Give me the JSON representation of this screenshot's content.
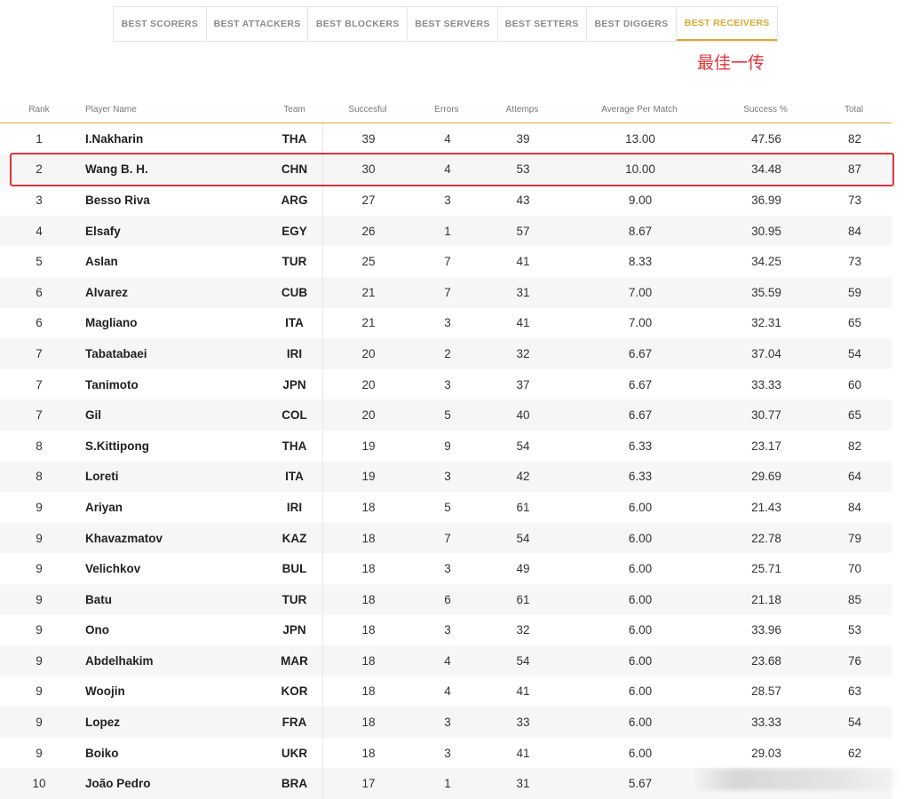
{
  "tabs": [
    {
      "label": "BEST SCORERS",
      "active": false
    },
    {
      "label": "BEST ATTACKERS",
      "active": false
    },
    {
      "label": "BEST BLOCKERS",
      "active": false
    },
    {
      "label": "BEST SERVERS",
      "active": false
    },
    {
      "label": "BEST SETTERS",
      "active": false
    },
    {
      "label": "BEST DIGGERS",
      "active": false
    },
    {
      "label": "BEST RECEIVERS",
      "active": true
    }
  ],
  "annotation": "最佳一传",
  "columns": [
    "Rank",
    "Player Name",
    "Team",
    "Succesful",
    "Errors",
    "Attemps",
    "Average Per Match",
    "Success %",
    "Total"
  ],
  "rows": [
    [
      "1",
      "I.Nakharin",
      "THA",
      "39",
      "4",
      "39",
      "13.00",
      "47.56",
      "82"
    ],
    [
      "2",
      "Wang B. H.",
      "CHN",
      "30",
      "4",
      "53",
      "10.00",
      "34.48",
      "87"
    ],
    [
      "3",
      "Besso Riva",
      "ARG",
      "27",
      "3",
      "43",
      "9.00",
      "36.99",
      "73"
    ],
    [
      "4",
      "Elsafy",
      "EGY",
      "26",
      "1",
      "57",
      "8.67",
      "30.95",
      "84"
    ],
    [
      "5",
      "Aslan",
      "TUR",
      "25",
      "7",
      "41",
      "8.33",
      "34.25",
      "73"
    ],
    [
      "6",
      "Alvarez",
      "CUB",
      "21",
      "7",
      "31",
      "7.00",
      "35.59",
      "59"
    ],
    [
      "6",
      "Magliano",
      "ITA",
      "21",
      "3",
      "41",
      "7.00",
      "32.31",
      "65"
    ],
    [
      "7",
      "Tabatabaei",
      "IRI",
      "20",
      "2",
      "32",
      "6.67",
      "37.04",
      "54"
    ],
    [
      "7",
      "Tanimoto",
      "JPN",
      "20",
      "3",
      "37",
      "6.67",
      "33.33",
      "60"
    ],
    [
      "7",
      "Gil",
      "COL",
      "20",
      "5",
      "40",
      "6.67",
      "30.77",
      "65"
    ],
    [
      "8",
      "S.Kittipong",
      "THA",
      "19",
      "9",
      "54",
      "6.33",
      "23.17",
      "82"
    ],
    [
      "8",
      "Loreti",
      "ITA",
      "19",
      "3",
      "42",
      "6.33",
      "29.69",
      "64"
    ],
    [
      "9",
      "Ariyan",
      "IRI",
      "18",
      "5",
      "61",
      "6.00",
      "21.43",
      "84"
    ],
    [
      "9",
      "Khavazmatov",
      "KAZ",
      "18",
      "7",
      "54",
      "6.00",
      "22.78",
      "79"
    ],
    [
      "9",
      "Velichkov",
      "BUL",
      "18",
      "3",
      "49",
      "6.00",
      "25.71",
      "70"
    ],
    [
      "9",
      "Batu",
      "TUR",
      "18",
      "6",
      "61",
      "6.00",
      "21.18",
      "85"
    ],
    [
      "9",
      "Ono",
      "JPN",
      "18",
      "3",
      "32",
      "6.00",
      "33.96",
      "53"
    ],
    [
      "9",
      "Abdelhakim",
      "MAR",
      "18",
      "4",
      "54",
      "6.00",
      "23.68",
      "76"
    ],
    [
      "9",
      "Woojin",
      "KOR",
      "18",
      "4",
      "41",
      "6.00",
      "28.57",
      "63"
    ],
    [
      "9",
      "Lopez",
      "FRA",
      "18",
      "3",
      "33",
      "6.00",
      "33.33",
      "54"
    ],
    [
      "9",
      "Boiko",
      "UKR",
      "18",
      "3",
      "41",
      "6.00",
      "29.03",
      "62"
    ],
    [
      "10",
      "João Pedro",
      "BRA",
      "17",
      "1",
      "31",
      "5.67",
      "",
      ""
    ]
  ],
  "colors": {
    "accent": "#e0a637",
    "highlight": "#e0333a"
  }
}
